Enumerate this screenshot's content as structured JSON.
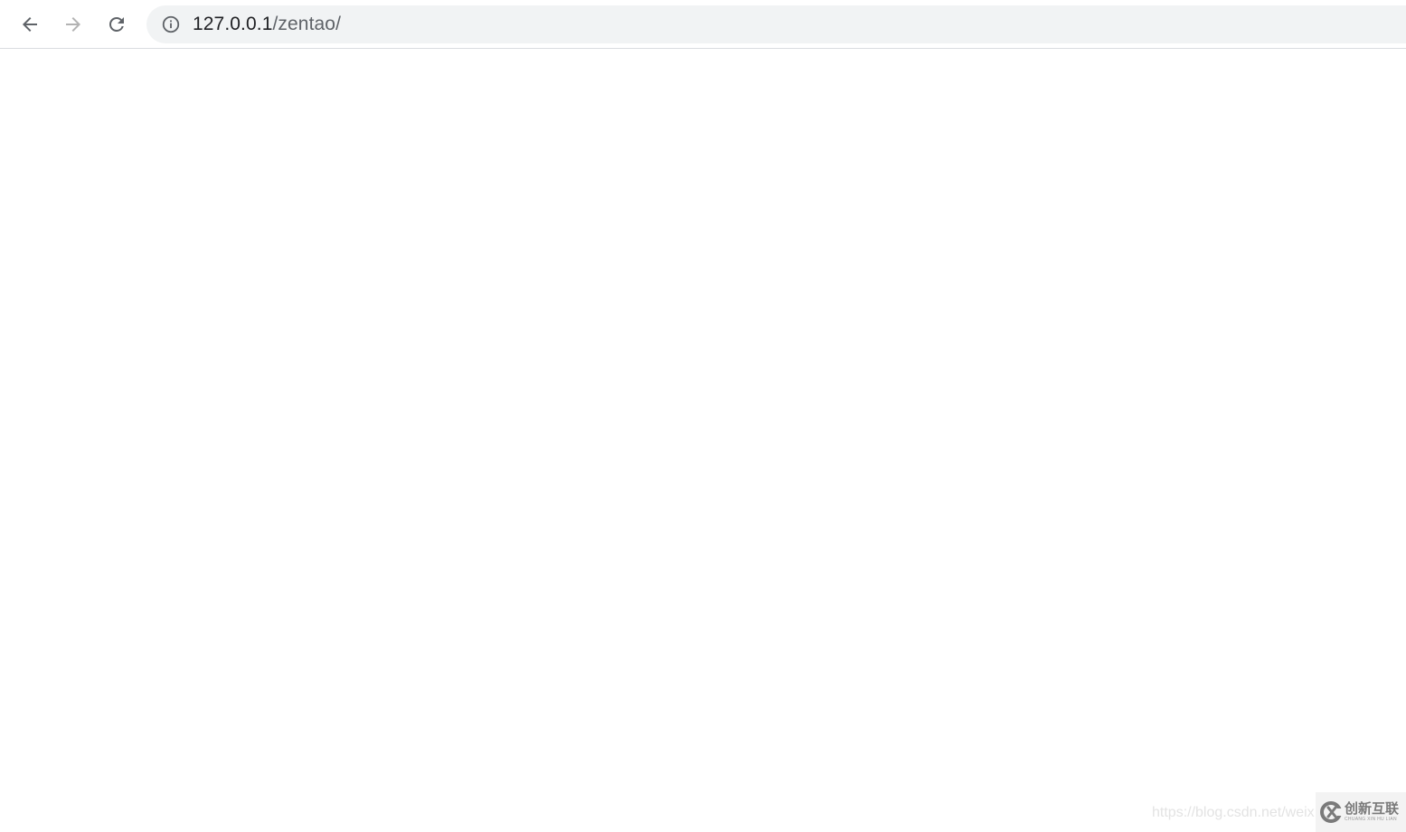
{
  "toolbar": {
    "back_icon": "arrow-left-icon",
    "forward_icon": "arrow-right-icon",
    "reload_icon": "reload-icon"
  },
  "omnibox": {
    "security_icon": "info-icon",
    "url_host": "127.0.0.1",
    "url_path": "/zentao/"
  },
  "watermark": {
    "text": "https://blog.csdn.net/weixi"
  },
  "logo": {
    "cn_text": "创新互联",
    "en_text": "CHUANG XIN HU LIAN"
  },
  "colors": {
    "toolbar_bg": "#ffffff",
    "omnibox_bg": "#f1f3f4",
    "icon_active": "#5f6368",
    "icon_disabled": "#b3b3b3",
    "url_text": "#202124"
  }
}
